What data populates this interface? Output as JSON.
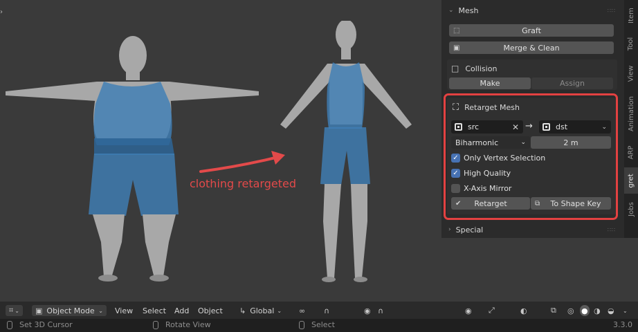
{
  "viewport": {
    "annotation": "clothing retargeted",
    "annotation_color": "#e34a4a"
  },
  "npanel": {
    "tabs": [
      "Item",
      "Tool",
      "View",
      "Animation",
      "ARP",
      "gret",
      "Jobs"
    ],
    "active_tab": "gret",
    "mesh_header": "Mesh",
    "graft_label": "Graft",
    "merge_clean_label": "Merge & Clean",
    "collision_label": "Collision",
    "make_label": "Make",
    "assign_label": "Assign",
    "retarget_header": "Retarget Mesh",
    "src_value": "src",
    "dst_value": "dst",
    "method_value": "Biharmonic",
    "distance_value": "2 m",
    "only_vertex_selection": {
      "label": "Only Vertex Selection",
      "checked": true
    },
    "high_quality": {
      "label": "High Quality",
      "checked": true
    },
    "x_axis_mirror": {
      "label": "X-Axis Mirror",
      "checked": false
    },
    "retarget_label": "Retarget",
    "shape_key_label": "To Shape Key",
    "special_header": "Special",
    "highlight_color": "#e34141"
  },
  "header_bar": {
    "mode": "Object Mode",
    "menus": [
      "View",
      "Select",
      "Add",
      "Object"
    ],
    "orientation": "Global"
  },
  "status_bar": {
    "left": "Set 3D Cursor",
    "middle": "Rotate View",
    "right": "Select",
    "version": "3.3.0"
  }
}
